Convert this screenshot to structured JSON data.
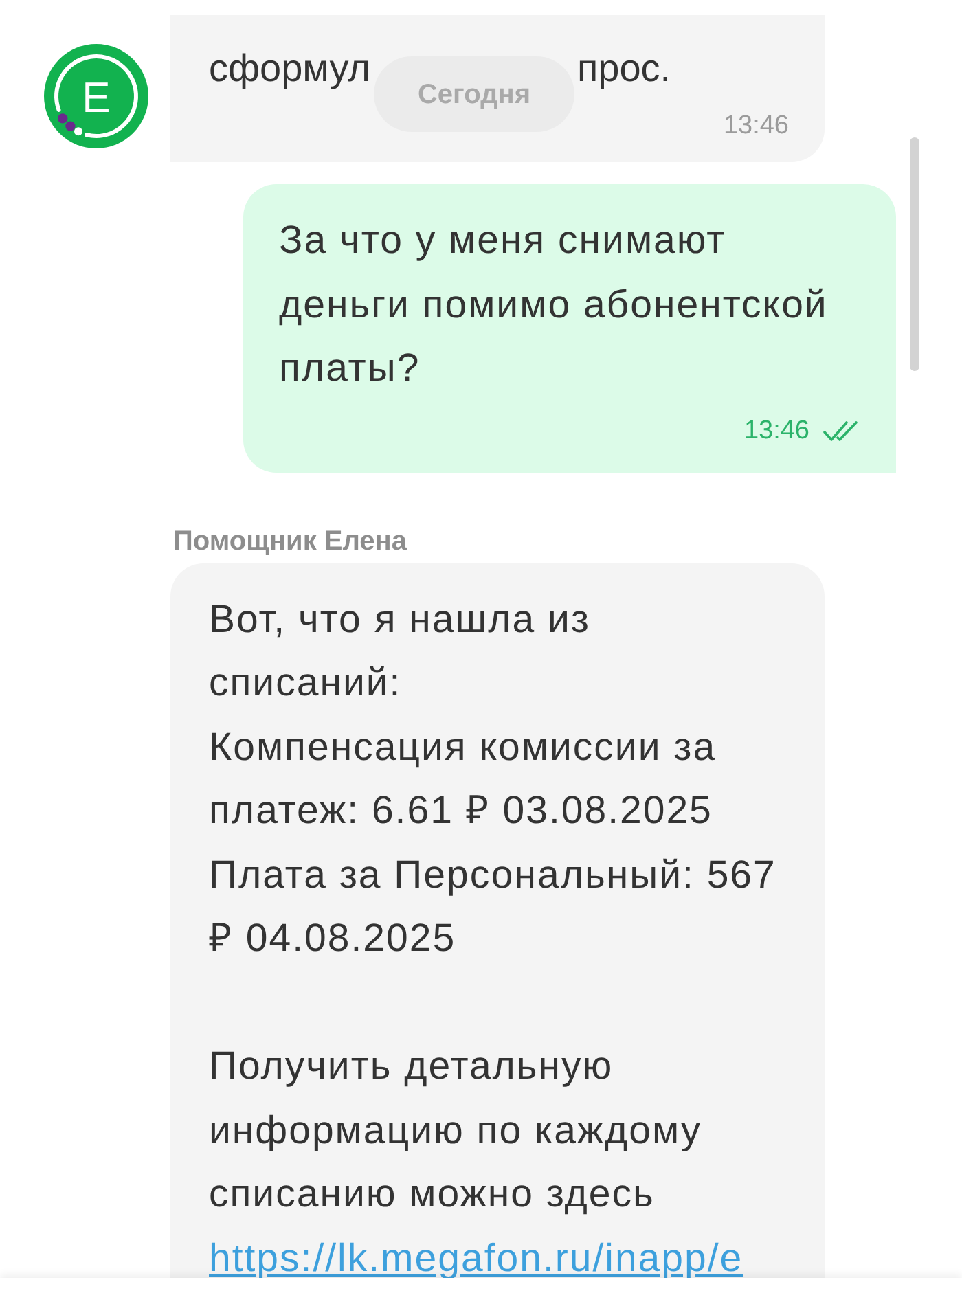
{
  "date_chip": "Сегодня",
  "messages": [
    {
      "kind": "incoming",
      "avatar": "Е",
      "fragments": [
        "сформул",
        "прос."
      ],
      "time": "13:46"
    },
    {
      "kind": "outgoing",
      "text": "За что у меня снимают\nденьги помимо абонентской\nплаты?",
      "time": "13:46",
      "read": true
    },
    {
      "kind": "incoming",
      "sender": "Помощник Елена",
      "text": "Вот, что я нашла из\nсписаний:\nКомпенсация комиссии за\nплатеж: 6.61 ₽ 03.08.2025\nПлата за Персональный: 567\n₽ 04.08.2025\n\nПолучить детальную\nинформацию по каждому\nсписанию можно здесь",
      "link": "https://lk.megafon.ru/inapp/e"
    }
  ]
}
